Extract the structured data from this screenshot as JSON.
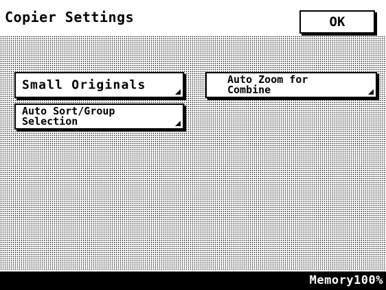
{
  "header": {
    "title": "Copier Settings",
    "ok_label": "OK"
  },
  "buttons": {
    "small_originals": "Small Originals",
    "auto_zoom": "Auto Zoom for\nCombine",
    "auto_sort": "Auto Sort/Group\nSelection"
  },
  "status": {
    "memory": "Memory100%"
  }
}
